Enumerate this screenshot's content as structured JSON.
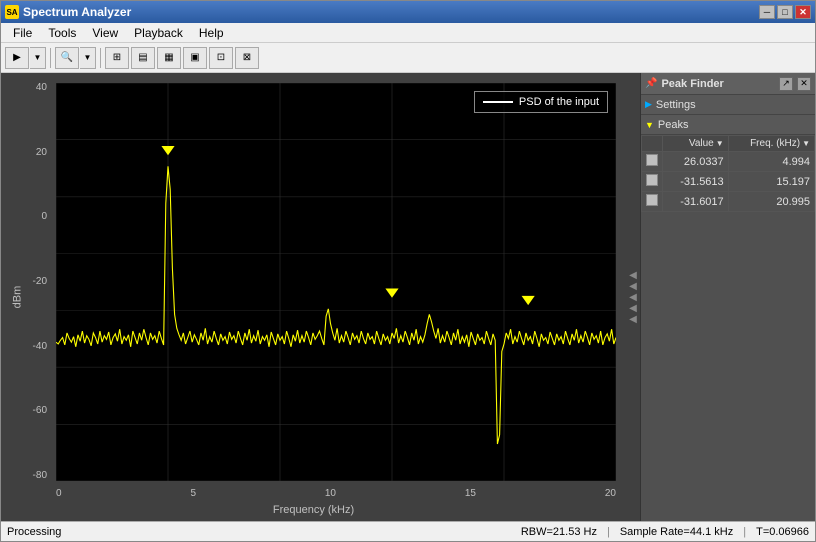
{
  "window": {
    "title": "Spectrum Analyzer",
    "icon": "★"
  },
  "titleButtons": {
    "minimize": "─",
    "maximize": "□",
    "close": "✕"
  },
  "menu": {
    "items": [
      "File",
      "Tools",
      "View",
      "Playback",
      "Help"
    ]
  },
  "toolbar": {
    "buttons": [
      "▶",
      "🔍",
      "⊞",
      "▤",
      "▦",
      "▣",
      "⊡",
      "⊠"
    ]
  },
  "plot": {
    "yAxisLabel": "dBm",
    "xAxisLabel": "Frequency (kHz)",
    "yLabels": [
      "40",
      "20",
      "0",
      "-20",
      "-40",
      "-60",
      "-80"
    ],
    "xLabels": [
      "0",
      "5",
      "10",
      "15",
      "20"
    ],
    "legend": "PSD of the input"
  },
  "peakFinder": {
    "title": "Peak Finder",
    "sections": {
      "settings": "Settings",
      "peaks": "Peaks"
    },
    "tableHeaders": {
      "check": "",
      "value": "Value",
      "freq": "Freq. (kHz)"
    },
    "peaks": [
      {
        "value": "26.0337",
        "freq": "4.994"
      },
      {
        "value": "-31.5613",
        "freq": "15.197"
      },
      {
        "value": "-31.6017",
        "freq": "20.995"
      }
    ]
  },
  "statusBar": {
    "left": "Processing",
    "rbw": "RBW=21.53 Hz",
    "sampleRate": "Sample Rate=44.1 kHz",
    "time": "T=0.06966"
  },
  "colors": {
    "accent": "#316ac5",
    "plotBg": "#000000",
    "plotLine": "#ffff00",
    "gridLine": "#444444",
    "peakMarker": "#ffff00"
  }
}
